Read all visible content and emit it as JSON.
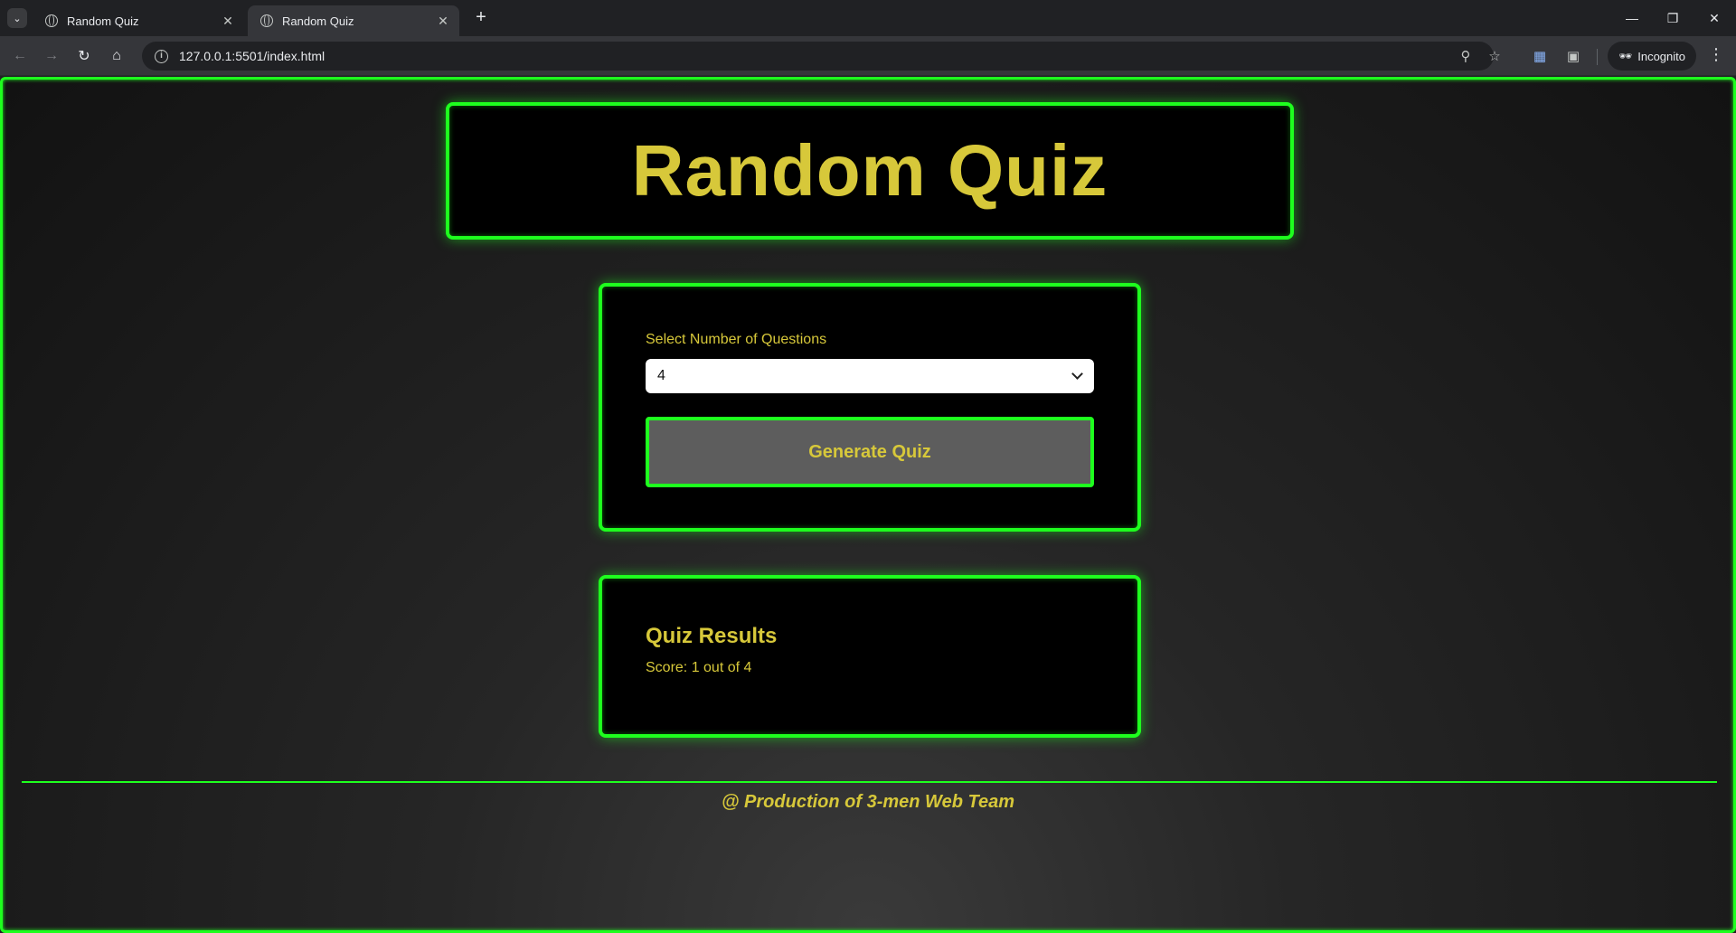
{
  "browser": {
    "tabs": [
      {
        "title": "Random Quiz",
        "active": false
      },
      {
        "title": "Random Quiz",
        "active": true
      }
    ],
    "url": "127.0.0.1:5501/index.html",
    "incognito_label": "Incognito",
    "icons": {
      "tab_search": "chevron-down-icon",
      "new_tab": "plus-icon",
      "minimize": "minimize-icon",
      "restore": "restore-icon",
      "close": "close-icon",
      "back": "back-arrow-icon",
      "forward": "forward-arrow-icon",
      "reload": "reload-icon",
      "home": "home-icon",
      "site_info": "info-icon",
      "zoom": "zoom-icon",
      "bookmark": "star-icon",
      "translate": "translate-icon",
      "extensions": "puzzle-icon",
      "menu": "kebab-icon"
    }
  },
  "page": {
    "title": "Random Quiz",
    "form": {
      "label": "Select Number of Questions",
      "selected_value": "4",
      "button_label": "Generate Quiz"
    },
    "results": {
      "title": "Quiz Results",
      "score": "Score: 1 out of 4"
    },
    "footer": "@ Production of 3-men Web Team"
  },
  "colors": {
    "neon_green": "#1eff1e",
    "title_yellow": "#d7c83a",
    "box_background": "#000000",
    "button_background": "#5d5d5d"
  }
}
